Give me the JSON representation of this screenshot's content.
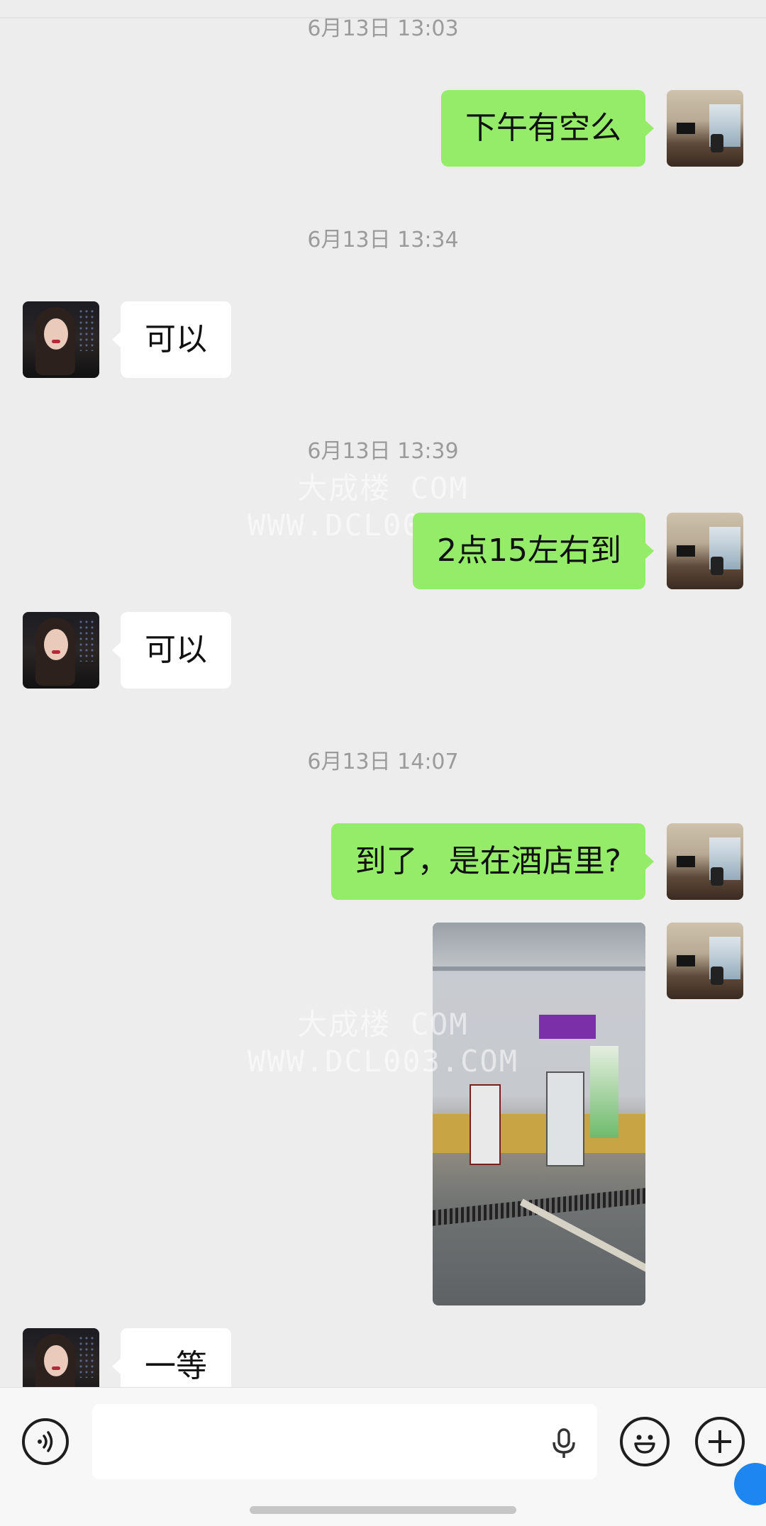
{
  "chat": {
    "timestamps": [
      "6月13日 13:03",
      "6月13日 13:34",
      "6月13日 13:39",
      "6月13日 14:07"
    ],
    "messages": [
      {
        "from": "self",
        "text": "下午有空么"
      },
      {
        "from": "other",
        "text": "可以"
      },
      {
        "from": "self",
        "text": "2点15左右到"
      },
      {
        "from": "other",
        "text": "可以"
      },
      {
        "from": "self",
        "text": "到了，是在酒店里?"
      },
      {
        "from": "self",
        "type": "image",
        "description": "parking garage photo"
      },
      {
        "from": "other",
        "text": "一等"
      }
    ]
  },
  "watermark": {
    "line1": "大成楼 COM",
    "line2": "WWW.DCL003.COM"
  },
  "input_bar": {
    "placeholder": "",
    "icons": [
      "voice-icon",
      "microphone-icon",
      "emoji-icon",
      "plus-icon"
    ]
  },
  "colors": {
    "background": "#ededed",
    "self_bubble": "#95ec69",
    "other_bubble": "#ffffff",
    "timestamp": "#9b9b9b"
  }
}
